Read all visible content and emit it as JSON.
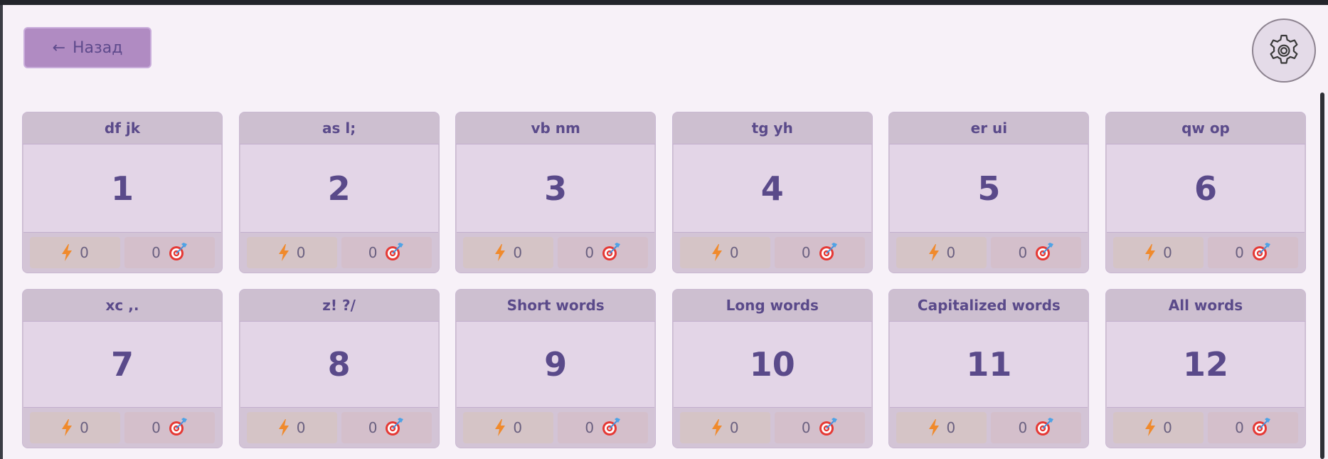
{
  "header": {
    "back_label": "Назад",
    "back_arrow": "←",
    "settings_icon": "gear-icon"
  },
  "colors": {
    "accent": "#5a4a8a",
    "lightning": "#f08a2c",
    "target": "#e53935"
  },
  "lessons": [
    {
      "title": "df jk",
      "number": "1",
      "speed": "0",
      "accuracy": "0"
    },
    {
      "title": "as l;",
      "number": "2",
      "speed": "0",
      "accuracy": "0"
    },
    {
      "title": "vb nm",
      "number": "3",
      "speed": "0",
      "accuracy": "0"
    },
    {
      "title": "tg yh",
      "number": "4",
      "speed": "0",
      "accuracy": "0"
    },
    {
      "title": "er ui",
      "number": "5",
      "speed": "0",
      "accuracy": "0"
    },
    {
      "title": "qw op",
      "number": "6",
      "speed": "0",
      "accuracy": "0"
    },
    {
      "title": "xc ,.",
      "number": "7",
      "speed": "0",
      "accuracy": "0"
    },
    {
      "title": "z! ?/",
      "number": "8",
      "speed": "0",
      "accuracy": "0"
    },
    {
      "title": "Short words",
      "number": "9",
      "speed": "0",
      "accuracy": "0"
    },
    {
      "title": "Long words",
      "number": "10",
      "speed": "0",
      "accuracy": "0"
    },
    {
      "title": "Capitalized words",
      "number": "11",
      "speed": "0",
      "accuracy": "0"
    },
    {
      "title": "All words",
      "number": "12",
      "speed": "0",
      "accuracy": "0"
    }
  ]
}
